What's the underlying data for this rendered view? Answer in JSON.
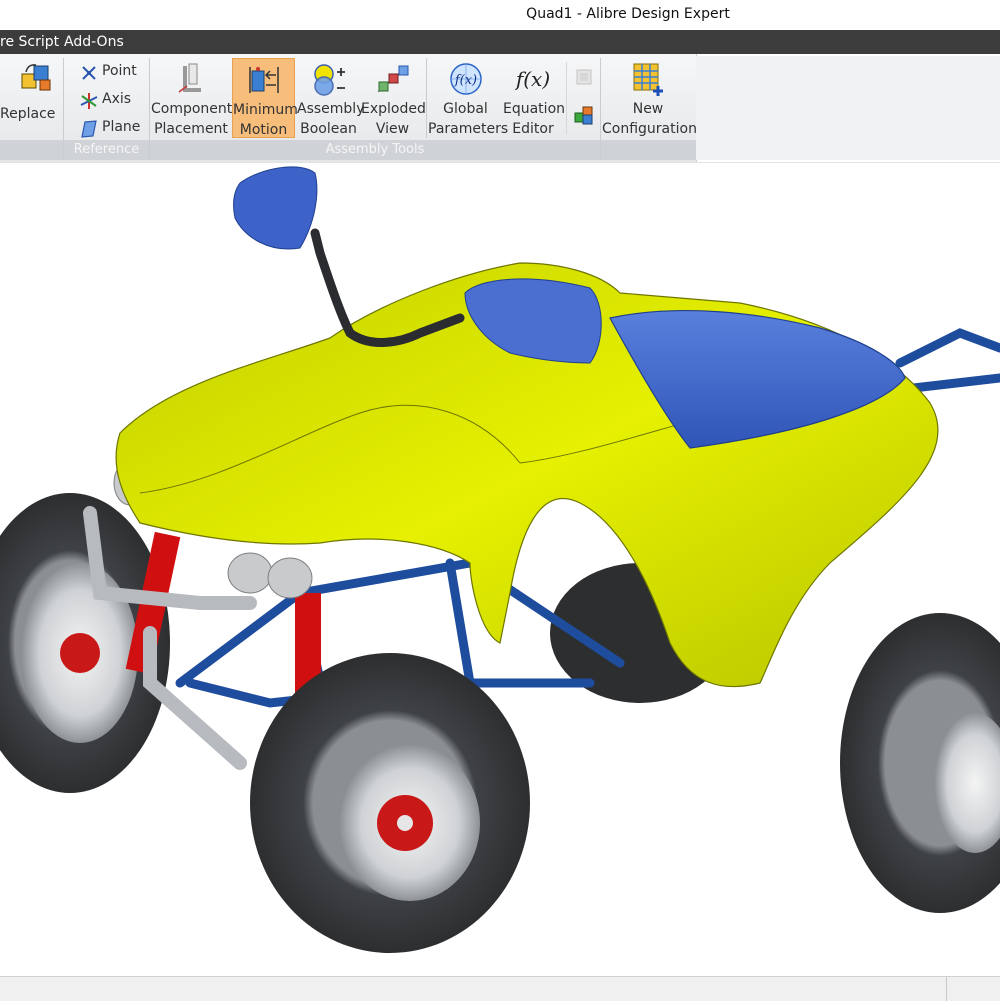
{
  "window": {
    "title": "Quad1 - Alibre Design Expert"
  },
  "menu": {
    "items": [
      "re Script",
      "Add-Ons"
    ]
  },
  "ribbon": {
    "replace_label": "Replace",
    "reference": {
      "label": "Reference",
      "point": "Point",
      "axis": "Axis",
      "plane": "Plane"
    },
    "assembly_tools": {
      "label": "Assembly Tools",
      "buttons": [
        {
          "line1": "Component",
          "line2": "Placement",
          "icon": "component-placement-icon"
        },
        {
          "line1": "Minimum",
          "line2": "Motion",
          "icon": "minimum-motion-icon",
          "active": true
        },
        {
          "line1": "Assembly",
          "line2": "Boolean",
          "icon": "assembly-boolean-icon"
        },
        {
          "line1": "Exploded",
          "line2": "View",
          "icon": "exploded-view-icon"
        },
        {
          "line1": "Global",
          "line2": "Parameters",
          "icon": "global-parameters-icon"
        },
        {
          "line1": "Equation",
          "line2": "Editor",
          "icon": "equation-editor-icon"
        }
      ]
    },
    "configuration": {
      "line1": "New",
      "line2": "Configuration",
      "icon": "new-configuration-icon"
    }
  },
  "viewport": {
    "model": "quad-bike-assembly"
  },
  "colors": {
    "menubar": "#3c3c3c",
    "active_button": "#f6bd7b",
    "body_yellow": "#d4e000",
    "seat_blue": "#3d63c8",
    "frame_blue": "#1f4d9e",
    "tire": "#3a3d40",
    "spring_red": "#d01010"
  }
}
